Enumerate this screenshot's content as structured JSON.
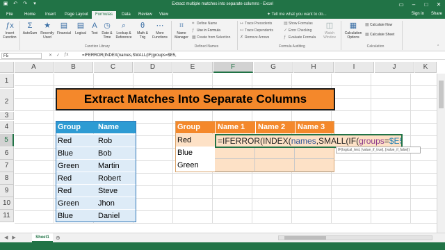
{
  "window": {
    "title": "Extract multiple matches into separate columns - Excel",
    "sign_in": "Sign in",
    "share": "Share"
  },
  "tabs": [
    {
      "label": "File"
    },
    {
      "label": "Home"
    },
    {
      "label": "Insert"
    },
    {
      "label": "Page Layout"
    },
    {
      "label": "Formulas"
    },
    {
      "label": "Data"
    },
    {
      "label": "Review"
    },
    {
      "label": "View"
    }
  ],
  "tell_me": "Tell me what you want to do...",
  "ribbon": {
    "insert_function": "Insert Function",
    "autosum": "AutoSum",
    "recently_used": "Recently Used",
    "financial": "Financial",
    "logical": "Logical",
    "text": "Text",
    "date_time": "Date & Time",
    "lookup_reference": "Lookup & Reference",
    "math_trig": "Math & Trig",
    "more_functions": "More Functions",
    "function_library": "Function Library",
    "name_manager": "Name Manager",
    "define_name": "Define Name",
    "use_in_formula": "Use in Formula",
    "create_from_selection": "Create from Selection",
    "defined_names": "Defined Names",
    "trace_precedents": "Trace Precedents",
    "trace_dependents": "Trace Dependents",
    "remove_arrows": "Remove Arrows",
    "show_formulas": "Show Formulas",
    "error_checking": "Error Checking",
    "evaluate_formula": "Evaluate Formula",
    "watch_window": "Watch Window",
    "formula_auditing": "Formula Auditing",
    "calculation_options": "Calculation Options",
    "calculate_now": "Calculate Now",
    "calculate_sheet": "Calculate Sheet",
    "calculation": "Calculation"
  },
  "formula_bar": {
    "name_box": "F5",
    "formula": "=IFERROR(INDEX(names,SMALL(IF(groups=$E5,"
  },
  "columns": [
    "A",
    "B",
    "C",
    "D",
    "E",
    "F",
    "G",
    "H",
    "I",
    "J",
    "K"
  ],
  "rows": [
    "1",
    "2",
    "3",
    "4",
    "5",
    "6",
    "7",
    "8",
    "9",
    "10",
    "11"
  ],
  "banner": "Extract Matches Into Separate Columns",
  "left_table": {
    "headers": [
      "Group",
      "Name"
    ],
    "rows": [
      [
        "Red",
        "Rob"
      ],
      [
        "Blue",
        "Bob"
      ],
      [
        "Green",
        "Martin"
      ],
      [
        "Red",
        "Robert"
      ],
      [
        "Red",
        "Steve"
      ],
      [
        "Green",
        "Jhon"
      ],
      [
        "Blue",
        "Daniel"
      ]
    ]
  },
  "right_table": {
    "headers": [
      "Group",
      "Name 1",
      "Name 2",
      "Name 3"
    ],
    "groups": [
      "Red",
      "Blue",
      "Green"
    ]
  },
  "edit_cell": {
    "prefix": "=IFERROR(INDEX(",
    "names": "names",
    "mid": ",SMALL(IF(",
    "groups": "groups",
    "eq": "=",
    "ref": "$E5",
    "suffix": ","
  },
  "tooltip": "IF(logical_test, [value_if_true], [value_if_false])",
  "sheet_tab": "Sheet1",
  "colors": {
    "excel_green": "#217346",
    "banner_orange": "#f4882b",
    "header_blue": "#2e9bd3",
    "row_blue": "#ddebf7",
    "peach": "#fde1c6"
  }
}
